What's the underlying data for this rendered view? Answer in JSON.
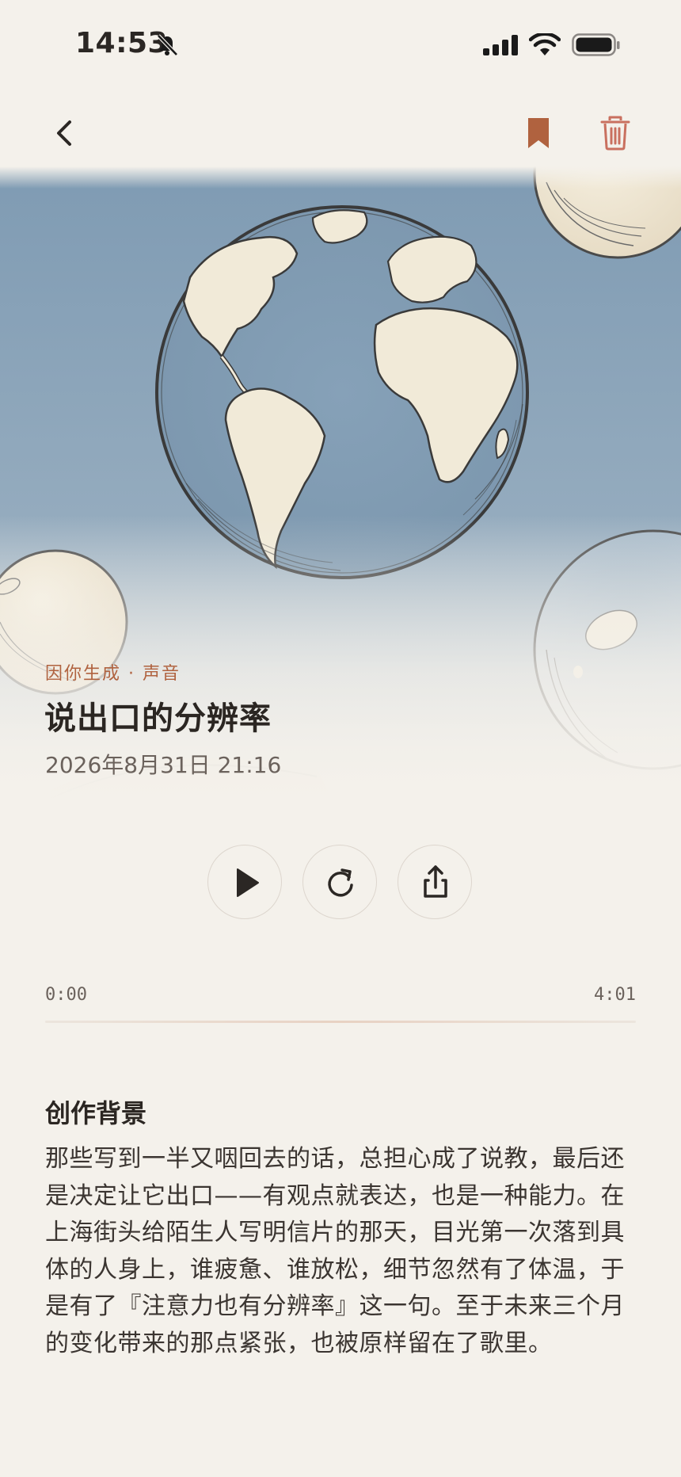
{
  "status_bar": {
    "time": "14:53",
    "icons": [
      "bell-slash-icon",
      "signal-icon",
      "wifi-icon",
      "battery-icon"
    ]
  },
  "nav": {
    "icons": [
      "chevron-left-icon",
      "bookmark-icon",
      "trash-icon"
    ],
    "accent_color": "#b0623f"
  },
  "hero": {
    "illustration": "hand-drawn globe with floating bubbles",
    "kicker": "因你生成 · 声音",
    "title": "说出口的分辨率",
    "date": "2026年8月31日 21:16"
  },
  "player": {
    "controls": [
      "play-icon",
      "replay-icon",
      "share-icon"
    ],
    "current_time": "0:00",
    "duration": "4:01",
    "progress": 0
  },
  "background": {
    "heading": "创作背景",
    "text": "那些写到一半又咽回去的话，总担心成了说教，最后还是决定让它出口——有观点就表达，也是一种能力。在上海街头给陌生人写明信片的那天，目光第一次落到具体的人身上，谁疲惫、谁放松，细节忽然有了体温，于是有了『注意力也有分辨率』这一句。至于未来三个月的变化带来的那点紧张，也被原样留在了歌里。"
  }
}
